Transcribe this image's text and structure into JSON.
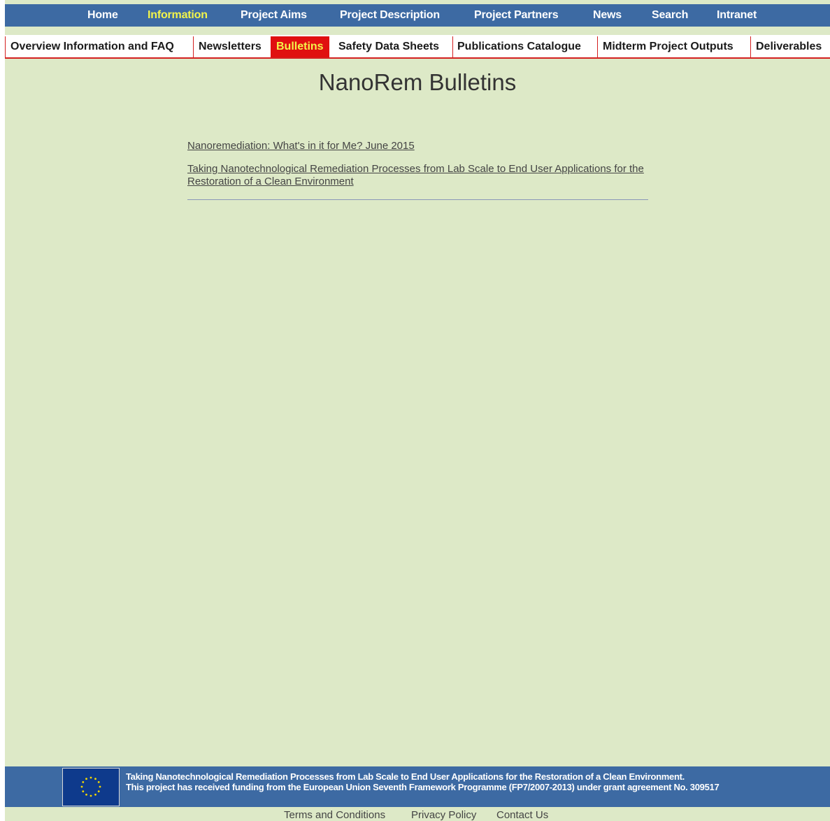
{
  "top_nav": {
    "items": [
      {
        "label": "Home",
        "active": false
      },
      {
        "label": "Information",
        "active": true
      },
      {
        "label": "Project Aims",
        "active": false
      },
      {
        "label": "Project Description",
        "active": false
      },
      {
        "label": "Project Partners",
        "active": false
      },
      {
        "label": "News",
        "active": false
      },
      {
        "label": "Search",
        "active": false
      },
      {
        "label": "Intranet",
        "active": false
      }
    ]
  },
  "sub_nav": {
    "items": [
      {
        "label": "Overview Information and FAQ",
        "active": false
      },
      {
        "label": "Newsletters",
        "active": false
      },
      {
        "label": "Bulletins",
        "active": true
      },
      {
        "label": "Safety Data Sheets",
        "active": false
      },
      {
        "label": "Publications Catalogue",
        "active": false
      },
      {
        "label": "Midterm Project Outputs",
        "active": false
      },
      {
        "label": "Deliverables",
        "active": false
      }
    ]
  },
  "main": {
    "title": "NanoRem Bulletins",
    "links": [
      {
        "text": "Nanoremediation: What's in it for Me? June 2015"
      },
      {
        "text": "Taking Nanotechnological Remediation Processes from Lab Scale to End User Applications for the Restoration of a Clean Environment"
      }
    ]
  },
  "footer": {
    "line1": "Taking Nanotechnological Remediation Processes from Lab Scale to End User Applications for the Restoration of a Clean Environment.",
    "line2": "This project has received funding from the European Union Seventh Framework Programme (FP7/2007-2013) under grant agreement No. 309517",
    "links": [
      {
        "text": "Terms and Conditions"
      },
      {
        "text": "Privacy Policy"
      },
      {
        "text": "Contact Us"
      }
    ]
  },
  "colors": {
    "nav_blue": "#3d6aa3",
    "page_bg": "#dde9c7",
    "active_yellow": "#f3f54a",
    "active_red": "#e01010",
    "subnav_border": "#d42020"
  },
  "icons": {
    "eu_flag": "eu-flag-icon"
  }
}
